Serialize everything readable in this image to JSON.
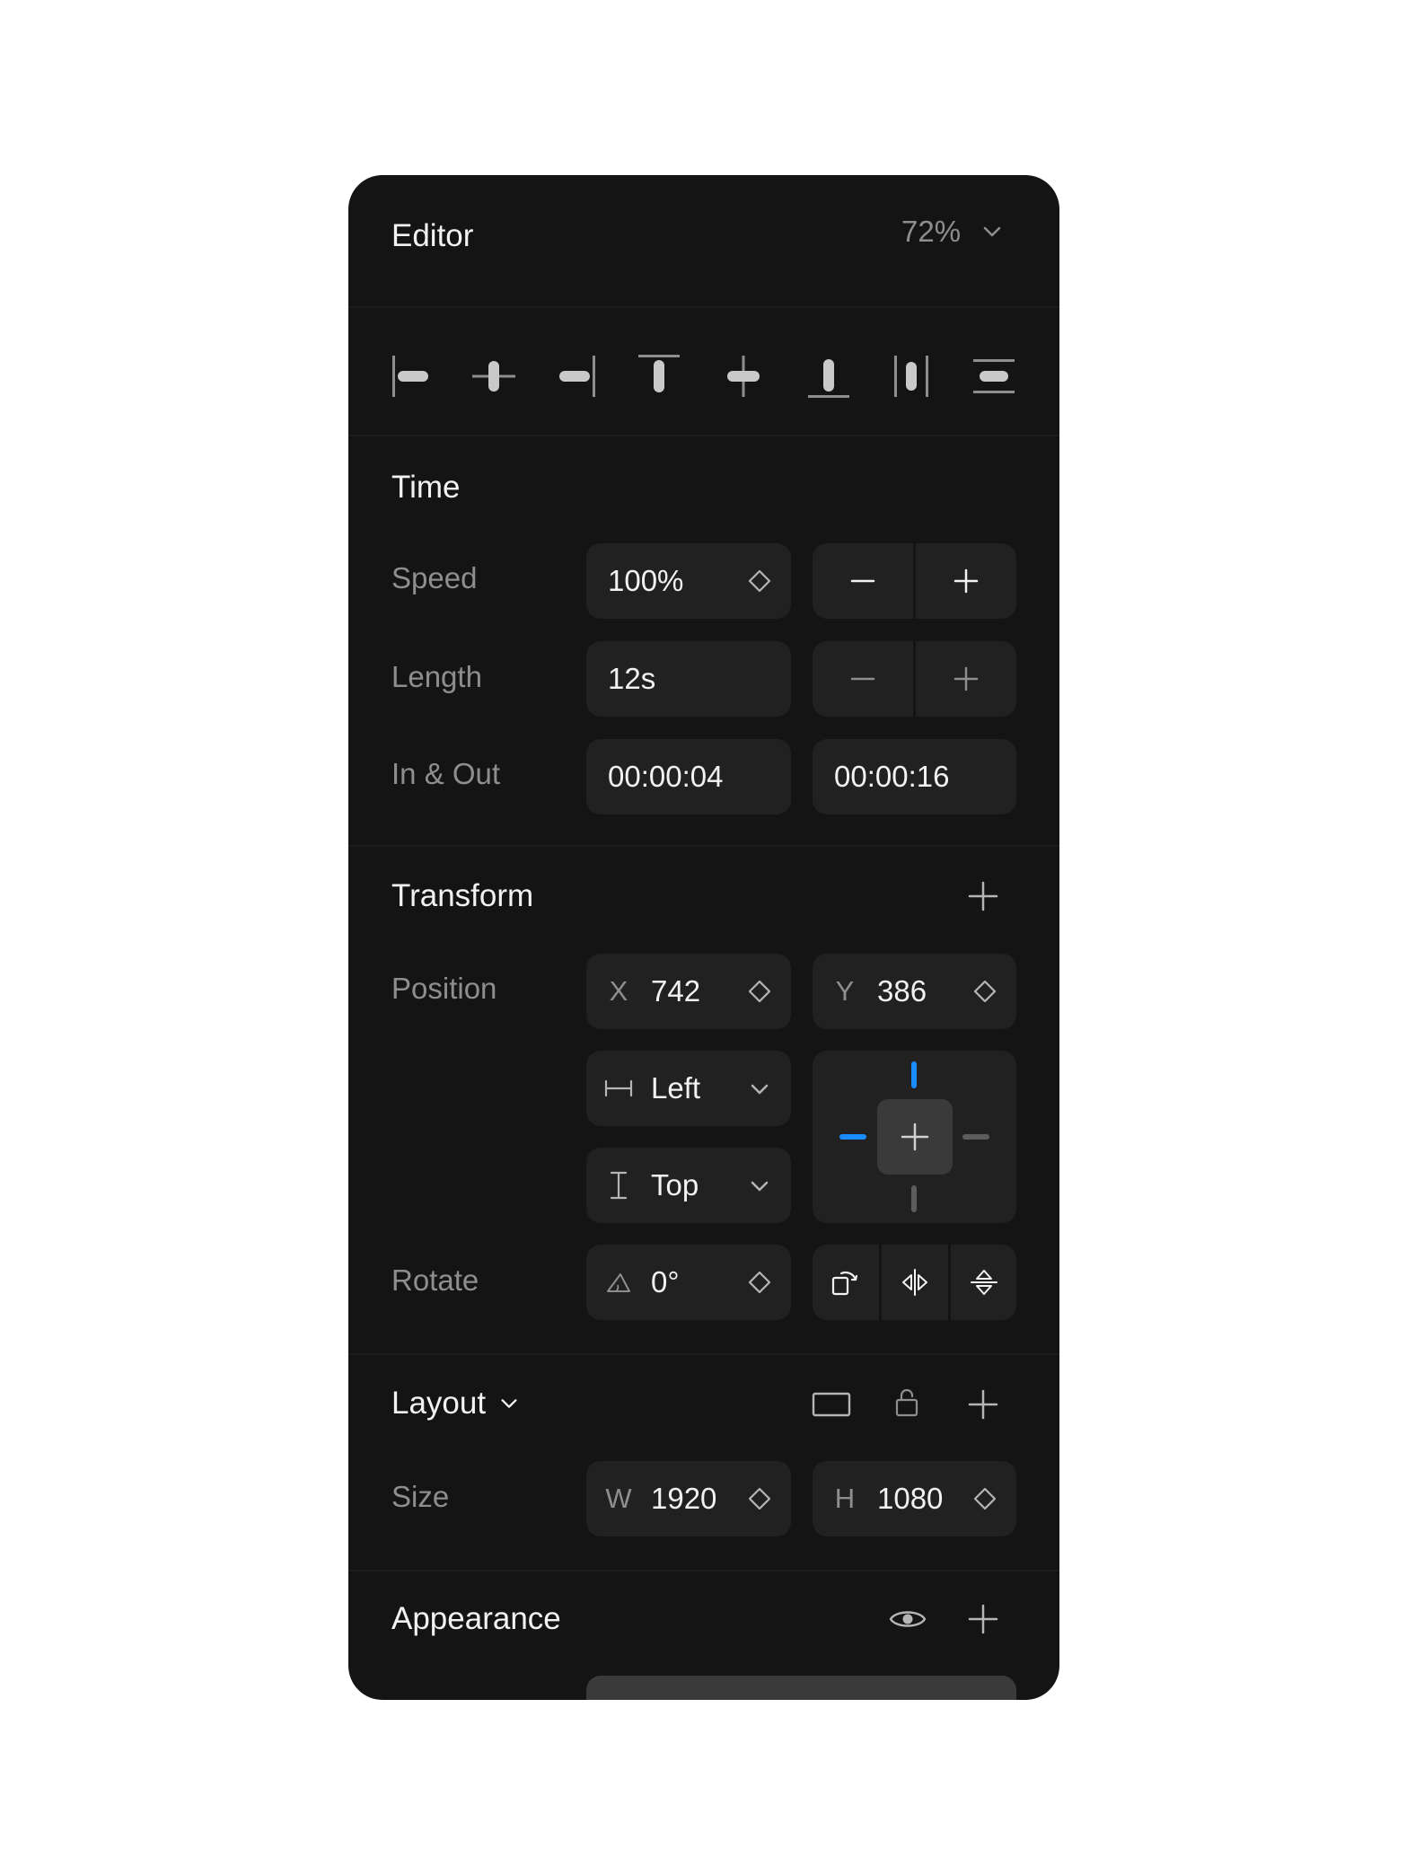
{
  "header": {
    "title": "Editor",
    "zoom": "72%"
  },
  "align_toolbar": {
    "icons": [
      "align-left-icon",
      "align-horizontal-center-icon",
      "align-right-icon",
      "align-top-icon",
      "align-vertical-center-icon",
      "align-bottom-icon",
      "distribute-horizontal-icon",
      "distribute-vertical-icon"
    ]
  },
  "time": {
    "title": "Time",
    "speed": {
      "label": "Speed",
      "value": "100%"
    },
    "length": {
      "label": "Length",
      "value": "12s"
    },
    "in_out": {
      "label": "In & Out",
      "in_value": "00:00:04",
      "out_value": "00:00:16"
    }
  },
  "transform": {
    "title": "Transform",
    "position": {
      "label": "Position",
      "x_prefix": "X",
      "x_value": "742",
      "y_prefix": "Y",
      "y_value": "386"
    },
    "horizontal_anchor": "Left",
    "vertical_anchor": "Top",
    "rotate": {
      "label": "Rotate",
      "value": "0°"
    }
  },
  "layout": {
    "title": "Layout",
    "size": {
      "label": "Size",
      "w_prefix": "W",
      "w_value": "1920",
      "h_prefix": "H",
      "h_value": "1080"
    }
  },
  "appearance": {
    "title": "Appearance"
  },
  "colors": {
    "panel_bg": "#141414",
    "field_bg": "#212121",
    "accent": "#1a8cff",
    "muted_text": "#8e8e8e"
  }
}
